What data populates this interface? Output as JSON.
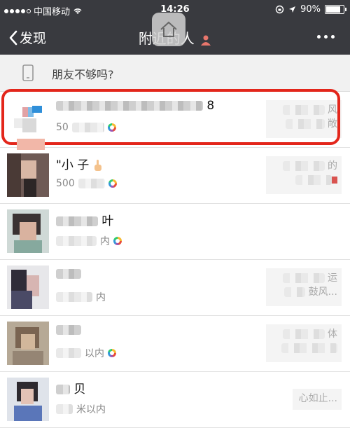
{
  "status_bar": {
    "carrier": "中国移动",
    "time": "14:26",
    "battery": "90%",
    "battery_level": 0.9
  },
  "nav": {
    "back_label": "发现",
    "title": "附近的人",
    "more_icon": "ellipsis-icon"
  },
  "hint": {
    "text": "朋友不够吗?"
  },
  "people": [
    {
      "name_visible": "8",
      "distance_visible": "50",
      "signature_visible": [
        "风",
        "敞"
      ],
      "has_moments_ring": true
    },
    {
      "name_visible": "\"小 子",
      "distance_visible": "500",
      "signature_visible": [
        "的"
      ],
      "has_moments_ring": true
    },
    {
      "name_visible": "叶",
      "distance_visible": "内",
      "signature_visible": [],
      "has_moments_ring": true
    },
    {
      "name_visible": "",
      "distance_visible": "内",
      "signature_visible": [
        "运",
        "鼓风..."
      ],
      "has_moments_ring": false
    },
    {
      "name_visible": "",
      "distance_visible": "以内",
      "signature_visible": [
        "体"
      ],
      "has_moments_ring": true
    },
    {
      "name_visible": "贝",
      "distance_visible": "米以内",
      "signature_visible": [
        "心如止..."
      ],
      "has_moments_ring": false
    }
  ],
  "colors": {
    "nav_bg": "#393a3f",
    "highlight_border": "#e3261b",
    "page_bg": "#f1f1f1"
  }
}
